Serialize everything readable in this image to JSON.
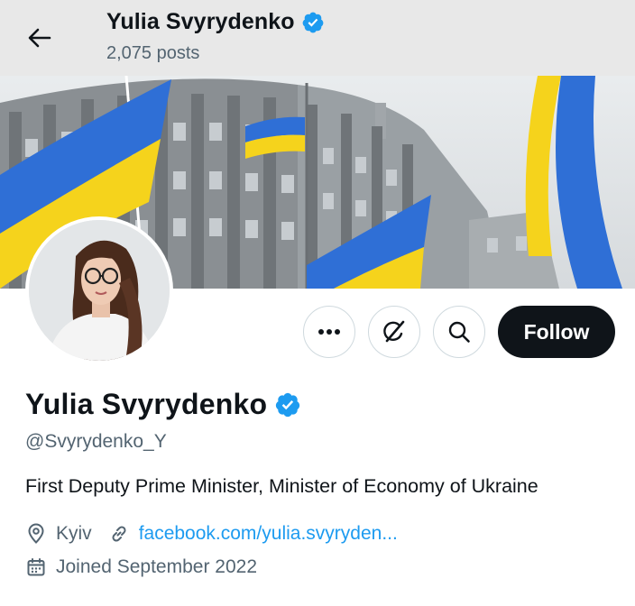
{
  "header": {
    "name": "Yulia Svyrydenko",
    "posts": "2,075 posts"
  },
  "profile": {
    "display_name": "Yulia Svyrydenko",
    "handle": "@Svyrydenko_Y",
    "bio": "First Deputy Prime Minister, Minister of Economy of Ukraine",
    "location": "Kyiv",
    "website": "facebook.com/yulia.svyryden...",
    "joined": "Joined September 2022"
  },
  "actions": {
    "follow_label": "Follow"
  },
  "icons": {
    "back": "arrow-left-icon",
    "verified": "verified-badge-icon",
    "more": "more-dots-icon",
    "grok": "grok-icon",
    "search": "search-icon",
    "location": "location-pin-icon",
    "link": "link-icon",
    "calendar": "calendar-icon"
  },
  "colors": {
    "accent": "#1d9bf0",
    "follow_bg": "#0f1419",
    "muted_text": "#536471",
    "flag_blue": "#2f6fd6",
    "flag_yellow": "#f5d31c"
  }
}
